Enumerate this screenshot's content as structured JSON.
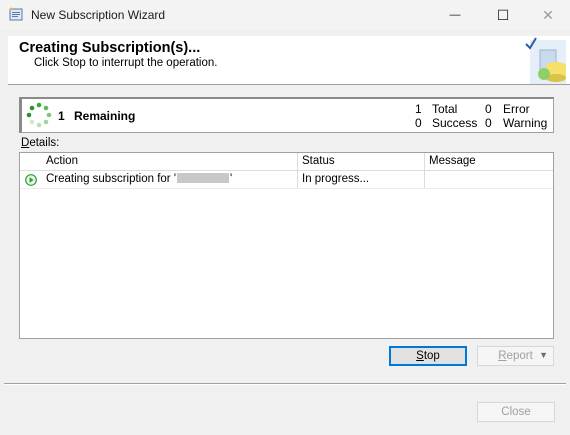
{
  "window": {
    "title": "New Subscription Wizard",
    "minimize_glyph": "—",
    "maximize_glyph": "☐",
    "close_glyph": "✕"
  },
  "header": {
    "title": "Creating Subscription(s)...",
    "subtitle": "Click Stop to interrupt the operation."
  },
  "status": {
    "remaining_count": "1",
    "remaining_label": "Remaining",
    "total_count": "1",
    "total_label": "Total",
    "success_count": "0",
    "success_label": "Success",
    "error_count": "0",
    "error_label": "Error",
    "warning_count": "0",
    "warning_label": "Warning"
  },
  "details": {
    "label_accel": "D",
    "label_rest": "etails:",
    "columns": [
      "Action",
      "Status",
      "Message"
    ],
    "rows": [
      {
        "action_prefix": "Creating subscription for '",
        "action_suffix": "'",
        "status": "In progress...",
        "message": ""
      }
    ]
  },
  "buttons": {
    "stop_accel": "S",
    "stop_rest": "top",
    "report_accel": "R",
    "report_rest": "eport",
    "report_caret": "▼",
    "close": "Close"
  },
  "colors": {
    "focus_border": "#0078d7",
    "spinner_green": "#3aa33a",
    "running_green": "#2e9e3a",
    "disabled_text": "#a0a0a0"
  },
  "icons": {
    "app": "wizard-app-icon",
    "header": "database-wizard-icon",
    "spinner": "progress-spinner-icon",
    "row": "running-icon"
  }
}
